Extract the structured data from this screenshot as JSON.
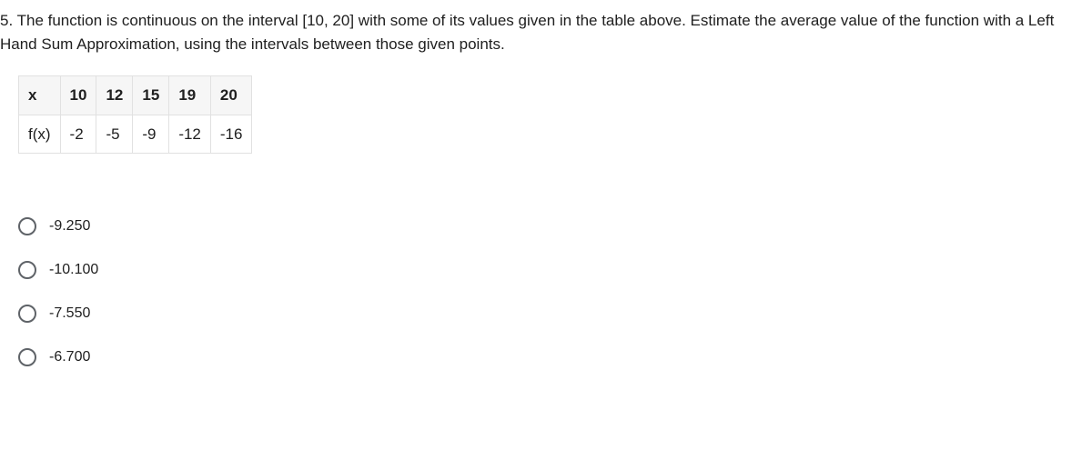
{
  "question": {
    "number": "5.",
    "text": "The function is continuous on the interval [10, 20] with some of its values given in the table above. Estimate the average value of the function with a Left Hand Sum Approximation, using the intervals between those given points."
  },
  "table": {
    "rows": [
      {
        "label": "x",
        "cells": [
          "10",
          "12",
          "15",
          "19",
          "20"
        ],
        "header": true
      },
      {
        "label": "f(x)",
        "cells": [
          "-2",
          "-5",
          "-9",
          "-12",
          "-16"
        ],
        "header": false
      }
    ]
  },
  "options": [
    {
      "label": "-9.250"
    },
    {
      "label": "-10.100"
    },
    {
      "label": "-7.550"
    },
    {
      "label": "-6.700"
    }
  ]
}
